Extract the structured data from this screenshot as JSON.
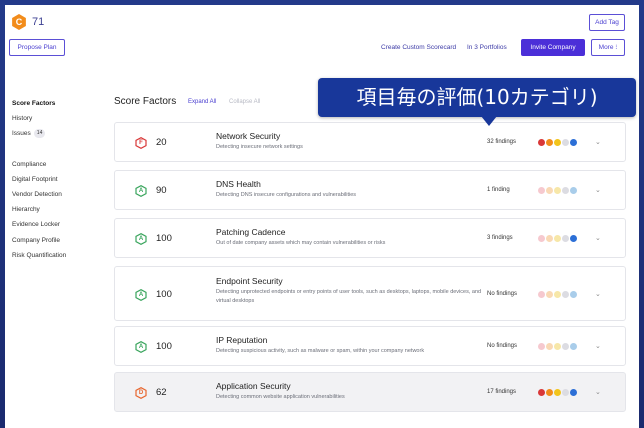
{
  "header": {
    "grade_letter": "C",
    "score": "71",
    "add_tag": "Add Tag",
    "propose_plan": "Propose Plan",
    "create_scorecard": "Create Custom Scorecard",
    "portfolios": "In 3 Portfolios",
    "invite_company": "Invite Company",
    "more": "More ⁝"
  },
  "sidebar": {
    "items": [
      {
        "label": "Score Factors"
      },
      {
        "label": "History"
      },
      {
        "label": "Issues",
        "badge": "14"
      },
      {
        "label": "Compliance"
      },
      {
        "label": "Digital Footprint"
      },
      {
        "label": "Vendor Detection"
      },
      {
        "label": "Hierarchy"
      },
      {
        "label": "Evidence Locker"
      },
      {
        "label": "Company Profile"
      },
      {
        "label": "Risk Quantification"
      }
    ]
  },
  "main": {
    "title": "Score Factors",
    "expand_all": "Expand All",
    "collapse_all": "Collapse All"
  },
  "annotation": "項目毎の評価(10カテゴリ)",
  "factors": [
    {
      "grade": "F",
      "grade_color": "#d93838",
      "score": "20",
      "title": "Network Security",
      "desc": "Detecting insecure network settings",
      "findings": "32 findings",
      "dots": [
        "#d93838",
        "#f28c1b",
        "#f2c41b",
        "#dcdce2",
        "#2c6fd6"
      ]
    },
    {
      "grade": "A",
      "grade_color": "#3aa55d",
      "score": "90",
      "title": "DNS Health",
      "desc": "Detecting DNS insecure configurations and vulnerabilities",
      "findings": "1 finding",
      "dots": [
        "#f6c9cf",
        "#f9d9b5",
        "#f7e7a8",
        "#dcdce2",
        "#a9cdea"
      ]
    },
    {
      "grade": "A",
      "grade_color": "#3aa55d",
      "score": "100",
      "title": "Patching Cadence",
      "desc": "Out of date company assets which may contain vulnerabilities or risks",
      "findings": "3 findings",
      "dots": [
        "#f6c9cf",
        "#f9d9b5",
        "#f7e7a8",
        "#dcdce2",
        "#2c6fd6"
      ]
    },
    {
      "grade": "A",
      "grade_color": "#3aa55d",
      "score": "100",
      "title": "Endpoint Security",
      "desc": "Detecting unprotected endpoints or entry points of user tools, such as desktops, laptops, mobile devices, and virtual desktops",
      "findings": "No findings",
      "dots": [
        "#f6c9cf",
        "#f9d9b5",
        "#f7e7a8",
        "#dcdce2",
        "#a9cdea"
      ]
    },
    {
      "grade": "A",
      "grade_color": "#3aa55d",
      "score": "100",
      "title": "IP Reputation",
      "desc": "Detecting suspicious activity, such as malware or spam, within your company network",
      "findings": "No findings",
      "dots": [
        "#f6c9cf",
        "#f9d9b5",
        "#f7e7a8",
        "#dcdce2",
        "#a9cdea"
      ]
    },
    {
      "grade": "D",
      "grade_color": "#e8662e",
      "score": "62",
      "title": "Application Security",
      "desc": "Detecting common website application vulnerabilities",
      "findings": "17 findings",
      "dots": [
        "#d93838",
        "#f28c1b",
        "#f2c41b",
        "#dcdce2",
        "#2c6fd6"
      ]
    }
  ]
}
